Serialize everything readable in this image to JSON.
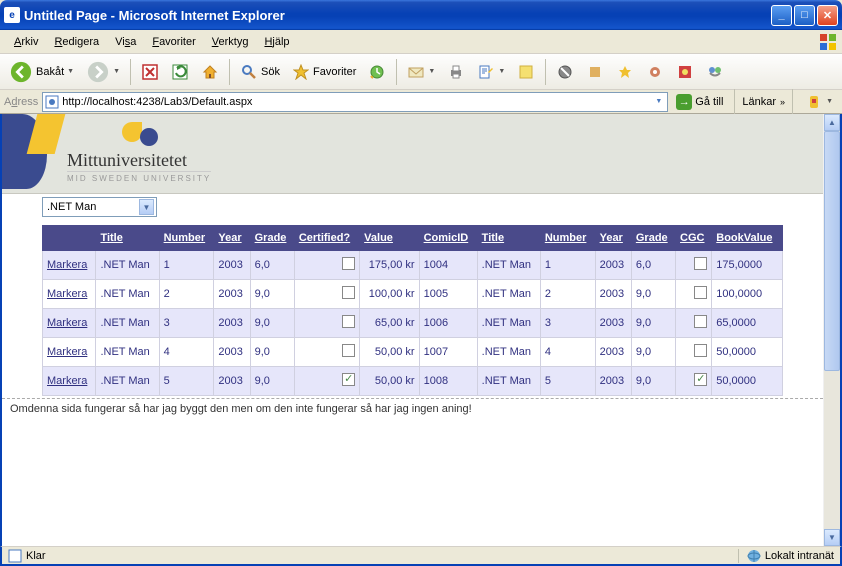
{
  "window": {
    "title": "Untitled Page - Microsoft Internet Explorer"
  },
  "menubar": {
    "arkiv": "Arkiv",
    "redigera": "Redigera",
    "visa": "Visa",
    "favoriter": "Favoriter",
    "verktyg": "Verktyg",
    "hjalp": "Hjälp"
  },
  "toolbar": {
    "back": "Bakåt",
    "search": "Sök",
    "favorites": "Favoriter"
  },
  "addressbar": {
    "label": "Adress",
    "url": "http://localhost:4238/Lab3/Default.aspx",
    "go": "Gå till",
    "links": "Länkar"
  },
  "page": {
    "logo_main": "Mittuniversitetet",
    "logo_sub": "MID SWEDEN UNIVERSITY",
    "dropdown_value": ".NET Man",
    "columns": [
      "",
      "Title",
      "Number",
      "Year",
      "Grade",
      "Certified?",
      "Value",
      "ComicID",
      "Title",
      "Number",
      "Year",
      "Grade",
      "CGC",
      "BookValue"
    ],
    "rows": [
      {
        "select": "Markera",
        "title": ".NET Man",
        "number": "1",
        "year": "2003",
        "grade": "6,0",
        "certified": false,
        "value": "175,00 kr",
        "comicid": "1004",
        "title2": ".NET Man",
        "number2": "1",
        "year2": "2003",
        "grade2": "6,0",
        "cgc": false,
        "bookvalue": "175,0000"
      },
      {
        "select": "Markera",
        "title": ".NET Man",
        "number": "2",
        "year": "2003",
        "grade": "9,0",
        "certified": false,
        "value": "100,00 kr",
        "comicid": "1005",
        "title2": ".NET Man",
        "number2": "2",
        "year2": "2003",
        "grade2": "9,0",
        "cgc": false,
        "bookvalue": "100,0000"
      },
      {
        "select": "Markera",
        "title": ".NET Man",
        "number": "3",
        "year": "2003",
        "grade": "9,0",
        "certified": false,
        "value": "65,00 kr",
        "comicid": "1006",
        "title2": ".NET Man",
        "number2": "3",
        "year2": "2003",
        "grade2": "9,0",
        "cgc": false,
        "bookvalue": "65,0000"
      },
      {
        "select": "Markera",
        "title": ".NET Man",
        "number": "4",
        "year": "2003",
        "grade": "9,0",
        "certified": false,
        "value": "50,00 kr",
        "comicid": "1007",
        "title2": ".NET Man",
        "number2": "4",
        "year2": "2003",
        "grade2": "9,0",
        "cgc": false,
        "bookvalue": "50,0000"
      },
      {
        "select": "Markera",
        "title": ".NET Man",
        "number": "5",
        "year": "2003",
        "grade": "9,0",
        "certified": true,
        "value": "50,00 kr",
        "comicid": "1008",
        "title2": ".NET Man",
        "number2": "5",
        "year2": "2003",
        "grade2": "9,0",
        "cgc": true,
        "bookvalue": "50,0000"
      }
    ],
    "footer": "Omdenna sida fungerar så har jag byggt den men om den inte fungerar så har jag ingen aning!"
  },
  "statusbar": {
    "text": "Klar",
    "zone": "Lokalt intranät"
  }
}
